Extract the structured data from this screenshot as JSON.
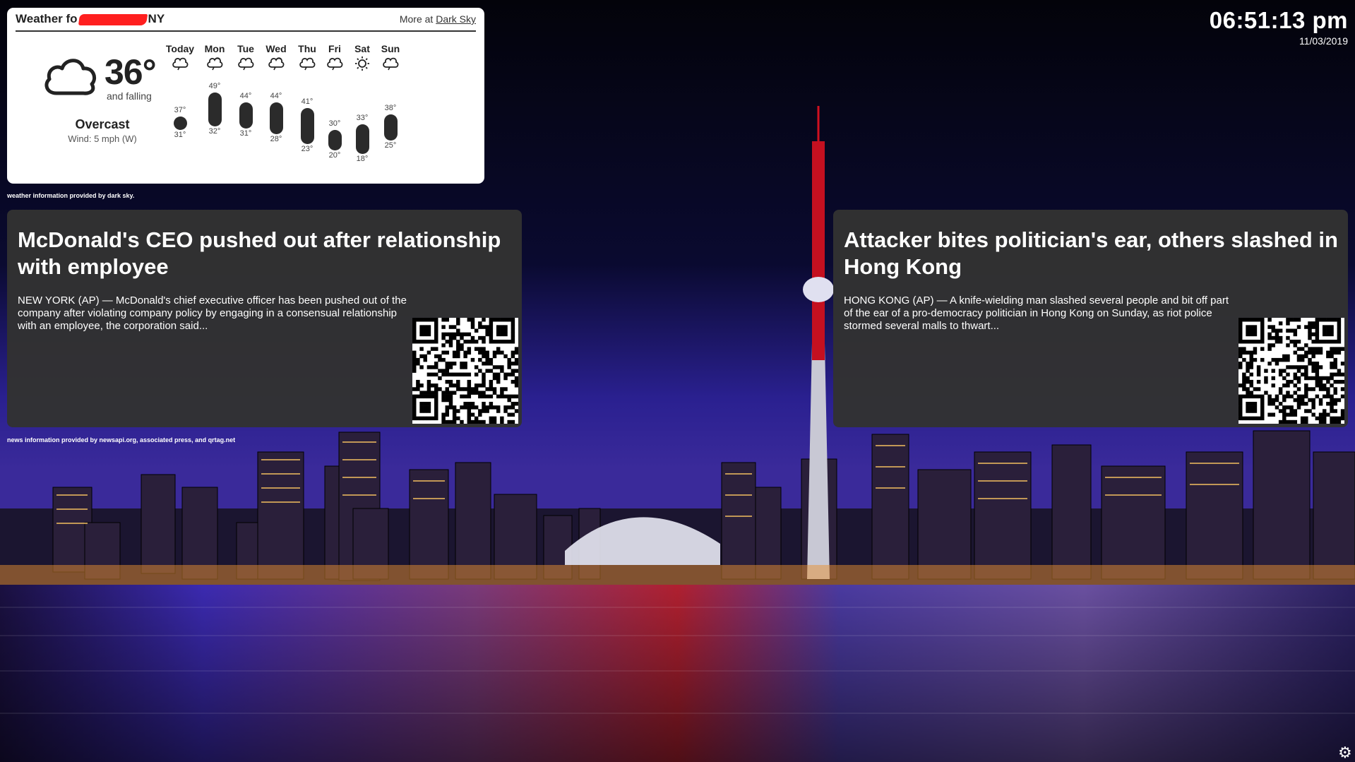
{
  "weather": {
    "title_prefix": "Weather fo",
    "title_suffix": "NY",
    "more_prefix": "More at ",
    "more_link": "Dark Sky",
    "current": {
      "temp": "36°",
      "trend": "and falling",
      "summary": "Overcast",
      "wind": "Wind: 5 mph (W)",
      "icon": "cloud-icon"
    },
    "days": [
      {
        "name": "Today",
        "icon": "cloud-icon",
        "hi": "37°",
        "lo": "31°",
        "hi_val": 37,
        "lo_val": 31
      },
      {
        "name": "Mon",
        "icon": "partly-cloudy-icon",
        "hi": "49°",
        "lo": "32°",
        "hi_val": 49,
        "lo_val": 32
      },
      {
        "name": "Tue",
        "icon": "cloud-icon",
        "hi": "44°",
        "lo": "31°",
        "hi_val": 44,
        "lo_val": 31
      },
      {
        "name": "Wed",
        "icon": "partly-cloudy-icon",
        "hi": "44°",
        "lo": "28°",
        "hi_val": 44,
        "lo_val": 28
      },
      {
        "name": "Thu",
        "icon": "cloud-icon",
        "hi": "41°",
        "lo": "23°",
        "hi_val": 41,
        "lo_val": 23
      },
      {
        "name": "Fri",
        "icon": "cloud-icon",
        "hi": "30°",
        "lo": "20°",
        "hi_val": 30,
        "lo_val": 20
      },
      {
        "name": "Sat",
        "icon": "sun-icon",
        "hi": "33°",
        "lo": "18°",
        "hi_val": 33,
        "lo_val": 18
      },
      {
        "name": "Sun",
        "icon": "cloud-icon",
        "hi": "38°",
        "lo": "25°",
        "hi_val": 38,
        "lo_val": 25
      }
    ],
    "credit": "weather information provided by dark sky."
  },
  "clock": {
    "time": "06:51:13 pm",
    "date": "11/03/2019"
  },
  "news": [
    {
      "title": "McDonald's CEO pushed out after relationship with employee",
      "body": "NEW YORK (AP) — McDonald's chief executive officer has been pushed out of the company after violating company policy by engaging in a consensual relationship with an employee, the corporation said..."
    },
    {
      "title": "Attacker bites politician's ear, others slashed in Hong Kong",
      "body": "HONG KONG (AP) — A knife-wielding man slashed several people and bit off part of the ear of a pro-democracy politician in Hong Kong on Sunday, as riot police stormed several malls to thwart..."
    }
  ],
  "news_credit": "news information provided by newsapi.org, associated press, and qrtag.net",
  "colors": {
    "card_bg": "#323232",
    "redaction": "#ff1f1f"
  }
}
